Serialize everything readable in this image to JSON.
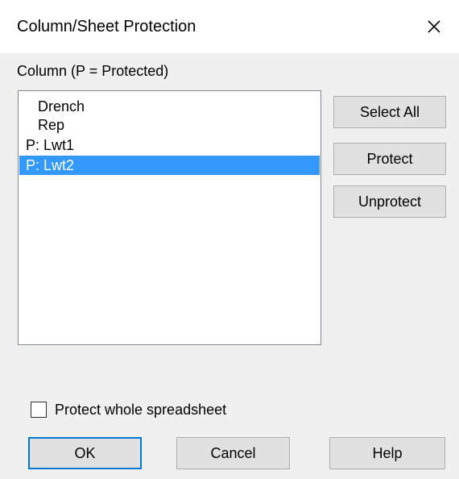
{
  "dialog": {
    "title": "Column/Sheet Protection",
    "close_glyph": "✕"
  },
  "column_section": {
    "label": "Column (P = Protected)"
  },
  "list": {
    "items": [
      {
        "text": "   Drench",
        "protected": false,
        "selected": false
      },
      {
        "text": "   Rep",
        "protected": false,
        "selected": false
      },
      {
        "text": "P: Lwt1",
        "protected": true,
        "selected": false
      },
      {
        "text": "P: Lwt2",
        "protected": true,
        "selected": true
      }
    ]
  },
  "buttons": {
    "select_all": "Select All",
    "protect": "Protect",
    "unprotect": "Unprotect",
    "ok": "OK",
    "cancel": "Cancel",
    "help": "Help"
  },
  "protect_whole": {
    "label": "Protect whole spreadsheet",
    "checked": false
  },
  "colors": {
    "selection": "#3399ff",
    "default_button_border": "#0078d7",
    "dialog_background": "#f0f0f0"
  }
}
